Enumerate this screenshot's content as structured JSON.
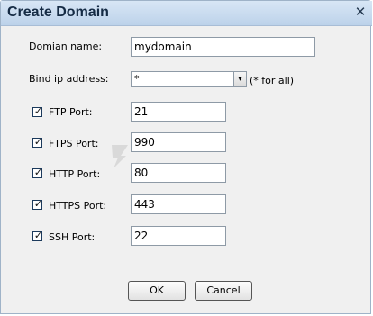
{
  "dialog": {
    "title": "Create Domain",
    "close_glyph": "✕"
  },
  "domain_name": {
    "label": "Domian name:",
    "value": "mydomain"
  },
  "bind_ip": {
    "label": "Bind ip address:",
    "value": "*",
    "hint": "(* for all)",
    "dropdown_glyph": "▾"
  },
  "ports": [
    {
      "label": "FTP Port:",
      "value": "21",
      "checked": true
    },
    {
      "label": "FTPS Port:",
      "value": "990",
      "checked": true
    },
    {
      "label": "HTTP Port:",
      "value": "80",
      "checked": true
    },
    {
      "label": "HTTPS Port:",
      "value": "443",
      "checked": true
    },
    {
      "label": "SSH Port:",
      "value": "22",
      "checked": true
    }
  ],
  "check_glyph": "✓",
  "buttons": {
    "ok": "OK",
    "cancel": "Cancel"
  },
  "colors": {
    "titlebar": "#c9dbef",
    "body": "#f0f0f0"
  }
}
